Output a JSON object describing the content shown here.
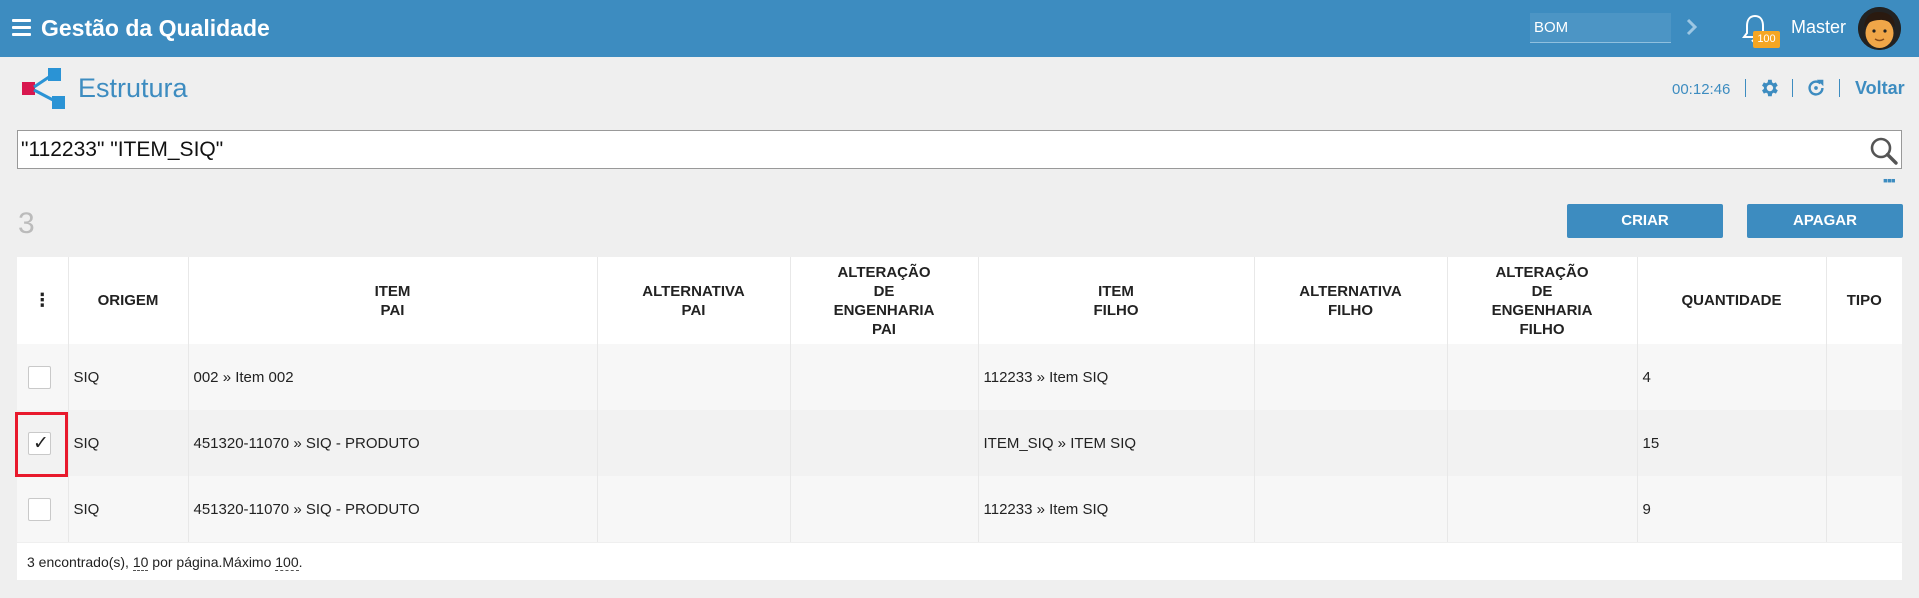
{
  "app": {
    "title": "Gestão da Qualidade"
  },
  "header": {
    "combo_value": "BOM",
    "notifications_count": "100",
    "user_name": "Master"
  },
  "page": {
    "title": "Estrutura",
    "timer": "00:12:46",
    "back_label": "Voltar"
  },
  "search": {
    "value": "\"112233\" \"ITEM_SIQ\""
  },
  "results": {
    "count": "3"
  },
  "actions": {
    "create_label": "CRIAR",
    "delete_label": "APAGAR"
  },
  "table": {
    "columns": [
      "ORIGEM",
      "ITEM\nPAI",
      "ALTERNATIVA\nPAI",
      "ALTERAÇÃO\nDE\nENGENHARIA\nPAI",
      "ITEM\nFILHO",
      "ALTERNATIVA\nFILHO",
      "ALTERAÇÃO\nDE\nENGENHARIA\nFILHO",
      "QUANTIDADE",
      "TIPO"
    ],
    "rows": [
      {
        "checked": false,
        "origem": "SIQ",
        "item_pai": "002 » Item 002",
        "alternativa_pai": "",
        "alteracao_pai": "",
        "item_filho": "112233 » Item SIQ",
        "alternativa_filho": "",
        "alteracao_filho": "",
        "quantidade": "4",
        "tipo": ""
      },
      {
        "checked": true,
        "origem": "SIQ",
        "item_pai": "451320-11070 » SIQ - PRODUTO",
        "alternativa_pai": "",
        "alteracao_pai": "",
        "item_filho": "ITEM_SIQ » ITEM SIQ",
        "alternativa_filho": "",
        "alteracao_filho": "",
        "quantidade": "15",
        "tipo": ""
      },
      {
        "checked": false,
        "origem": "SIQ",
        "item_pai": "451320-11070 » SIQ - PRODUTO",
        "alternativa_pai": "",
        "alteracao_pai": "",
        "item_filho": "112233 » Item SIQ",
        "alternativa_filho": "",
        "alteracao_filho": "",
        "quantidade": "9",
        "tipo": ""
      }
    ]
  },
  "footer": {
    "found_text": "3 encontrado(s), ",
    "per_page": "10",
    "per_page_text": " por página.Máximo ",
    "max": "100",
    "end": "."
  },
  "colors": {
    "primary": "#3d8cc0",
    "badge": "#f5a623",
    "highlight": "#e8192c"
  },
  "icons": [
    "menu-icon",
    "chevron-right-icon",
    "bell-icon",
    "avatar",
    "structure-icon",
    "gear-icon",
    "refresh-icon",
    "search-icon",
    "kebab-icon",
    "checkbox"
  ]
}
